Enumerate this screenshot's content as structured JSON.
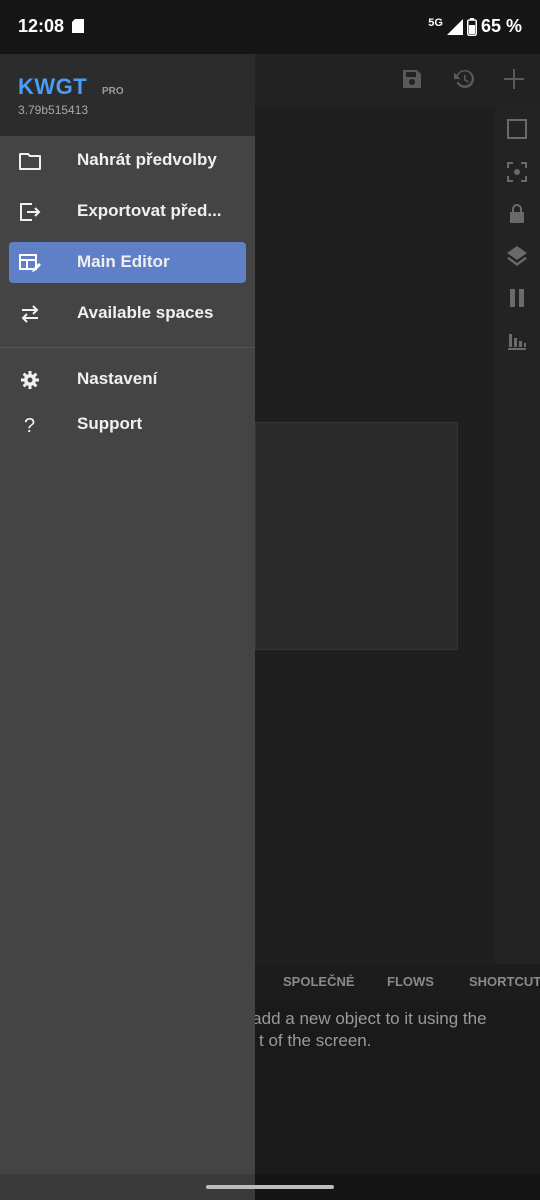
{
  "status": {
    "time": "12:08",
    "network": "5G",
    "battery": "65 %"
  },
  "background": {
    "tabs": [
      "SPOLEČNÉ",
      "FLOWS",
      "SHORTCUTS"
    ],
    "hint_line1": "n add a new object to it using the",
    "hint_line2": "t of the screen."
  },
  "drawer": {
    "brand": "KWGT",
    "pro": "PRO",
    "version": "3.79b515413",
    "items": [
      {
        "label": "Nahrát předvolby",
        "icon": "folder-icon"
      },
      {
        "label": "Exportovat před...",
        "icon": "export-icon"
      },
      {
        "label": "Main Editor",
        "icon": "editor-icon"
      },
      {
        "label": "Available spaces",
        "icon": "swap-icon"
      },
      {
        "label": "Nastavení",
        "icon": "gear-icon"
      },
      {
        "label": "Support",
        "icon": "help-icon"
      }
    ]
  },
  "colors": {
    "accent": "#4a9cf5",
    "active_item": "#5f7fc7",
    "drawer_bg": "#444444"
  }
}
